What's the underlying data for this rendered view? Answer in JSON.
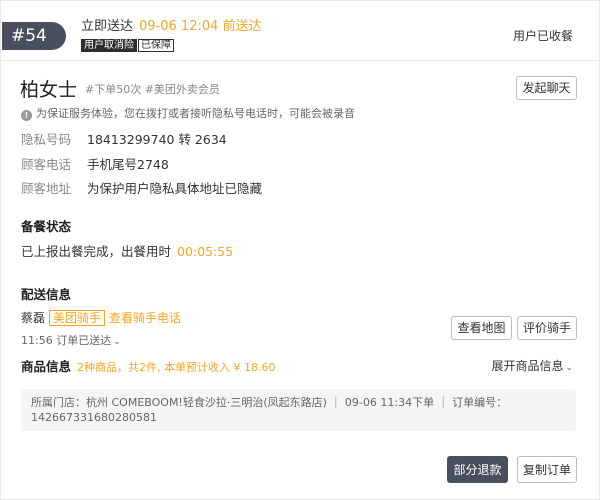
{
  "header": {
    "order_no": "#54",
    "deliver_label": "立即送达",
    "deliver_time": "09-06 12:04 前送达",
    "tag_cancel": "用户取消险",
    "tag_insured": "已保障",
    "status": "用户已收餐"
  },
  "customer": {
    "name": "柏女士",
    "meta": "#下单50次 #美团外卖会员",
    "chat_button": "发起聊天",
    "notice": "为保证服务体验，您在拨打或者接听隐私号电话时，可能会被录音",
    "rows": [
      {
        "label": "隐私号码",
        "value": "18413299740 转 2634"
      },
      {
        "label": "顾客电话",
        "value": "手机尾号2748"
      },
      {
        "label": "顾客地址",
        "value": "为保护用户隐私具体地址已隐藏"
      }
    ]
  },
  "meal": {
    "title": "备餐状态",
    "status": "已上报出餐完成，出餐用时",
    "elapsed": "00:05:55"
  },
  "delivery": {
    "title": "配送信息",
    "rider_name": "蔡磊",
    "rider_tag": "美团骑手",
    "rider_phone_link": "查看骑手电话",
    "sent_text": "11:56 订单已送达",
    "map_button": "查看地图",
    "rate_button": "评价骑手"
  },
  "goods": {
    "title": "商品信息",
    "summary": "2种商品，共2件, 本单预计收入 ¥ 18.60",
    "expand": "展开商品信息"
  },
  "store": {
    "line1": "所属门店：杭州 COMEBOOM!轻食沙拉·三明治(凤起东路店)  ｜  09-06 11:34下单  ｜  订单编号：",
    "line2": "142667331680280581"
  },
  "actions": {
    "refund": "部分退款",
    "copy": "复制订单"
  },
  "colors": {
    "accent": "#f5a623",
    "dark": "#4a4f5e"
  }
}
